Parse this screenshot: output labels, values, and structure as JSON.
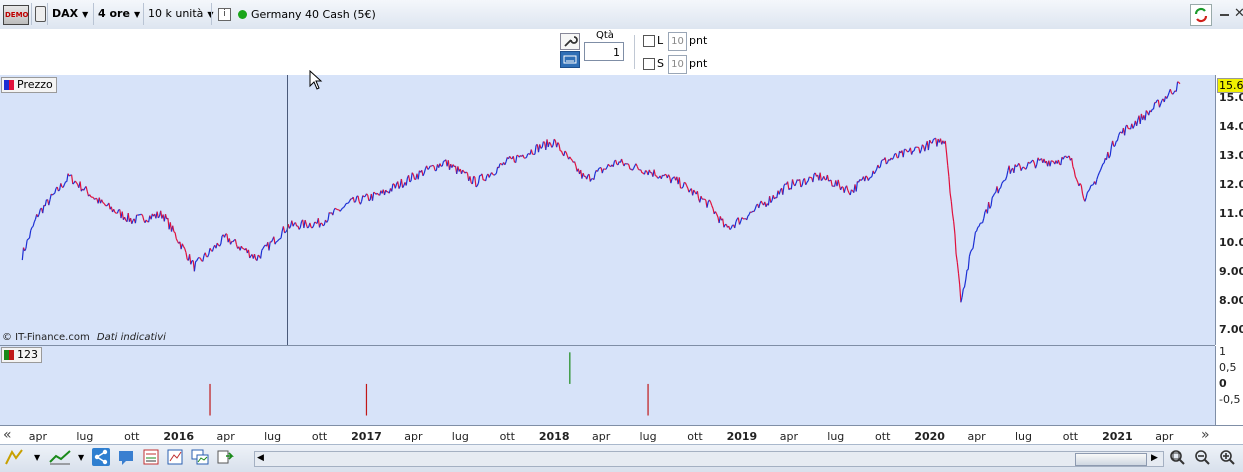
{
  "toolbar": {
    "demo_badge": "DEMO",
    "instrument": "DAX",
    "timeframe": "4 ore",
    "units": "10 k unità",
    "info_icon": "i",
    "market_name": "Germany 40 Cash (5€)"
  },
  "order": {
    "qty_label": "Qtà",
    "qty_value": "1",
    "long_label": "L",
    "long_value": "10",
    "long_unit": "pnt",
    "short_label": "S",
    "short_value": "10",
    "short_unit": "pnt"
  },
  "price_panel": {
    "legend": "Prezzo",
    "current_price_tag": "15.6",
    "y_ticks": [
      "15.0",
      "14.00",
      "13.00",
      "12.00",
      "11.00",
      "10.00",
      "9.00",
      "8.00",
      "7.00"
    ],
    "watermark": "© IT-Finance.com",
    "watermark_note": "Dati indicativi"
  },
  "indicator_panel": {
    "legend": "123",
    "y_ticks": [
      "1",
      "0,5",
      "0",
      "-0,5"
    ]
  },
  "time_axis": {
    "labels": [
      {
        "t": "apr",
        "year": false
      },
      {
        "t": "lug",
        "year": false
      },
      {
        "t": "ott",
        "year": false
      },
      {
        "t": "2016",
        "year": true
      },
      {
        "t": "apr",
        "year": false
      },
      {
        "t": "lug",
        "year": false
      },
      {
        "t": "ott",
        "year": false
      },
      {
        "t": "2017",
        "year": true
      },
      {
        "t": "apr",
        "year": false
      },
      {
        "t": "lug",
        "year": false
      },
      {
        "t": "ott",
        "year": false
      },
      {
        "t": "2018",
        "year": true
      },
      {
        "t": "apr",
        "year": false
      },
      {
        "t": "lug",
        "year": false
      },
      {
        "t": "ott",
        "year": false
      },
      {
        "t": "2019",
        "year": true
      },
      {
        "t": "apr",
        "year": false
      },
      {
        "t": "lug",
        "year": false
      },
      {
        "t": "ott",
        "year": false
      },
      {
        "t": "2020",
        "year": true
      },
      {
        "t": "apr",
        "year": false
      },
      {
        "t": "lug",
        "year": false
      },
      {
        "t": "ott",
        "year": false
      },
      {
        "t": "2021",
        "year": true
      },
      {
        "t": "apr",
        "year": false
      }
    ],
    "scroll_left": "«",
    "scroll_right": "»"
  },
  "chart_data": [
    {
      "type": "line",
      "series": [
        {
          "name": "Prezzo",
          "x": [
            "2015-03",
            "2015-04",
            "2015-06",
            "2015-08",
            "2015-10",
            "2015-12",
            "2016-02",
            "2016-04",
            "2016-06",
            "2016-08",
            "2016-10",
            "2016-12",
            "2017-02",
            "2017-04",
            "2017-06",
            "2017-08",
            "2017-10",
            "2017-12",
            "2018-01",
            "2018-03",
            "2018-05",
            "2018-07",
            "2018-09",
            "2018-11",
            "2018-12",
            "2019-02",
            "2019-04",
            "2019-06",
            "2019-08",
            "2019-10",
            "2019-12",
            "2020-02",
            "2020-03",
            "2020-04",
            "2020-06",
            "2020-08",
            "2020-10",
            "2020-11",
            "2021-01",
            "2021-03",
            "2021-05"
          ],
          "values": [
            9.6,
            11.0,
            12.3,
            11.4,
            10.8,
            11.0,
            9.2,
            10.2,
            9.5,
            10.6,
            10.7,
            11.4,
            11.7,
            12.3,
            12.8,
            12.1,
            12.8,
            13.3,
            13.5,
            12.2,
            12.8,
            12.5,
            12.1,
            11.3,
            10.5,
            11.2,
            12.0,
            12.3,
            11.8,
            12.8,
            13.2,
            13.6,
            8.1,
            10.5,
            12.5,
            12.8,
            12.9,
            11.5,
            13.7,
            14.5,
            15.5
          ]
        }
      ],
      "ylim": [
        6.5,
        15.8
      ],
      "colors": {
        "up": "#1c2fd4",
        "down": "#e0103c"
      }
    },
    {
      "type": "bar",
      "series": [
        {
          "x": [
            "2016-03",
            "2017-01",
            "2018-02",
            "2018-07"
          ],
          "values": [
            -1,
            -1,
            1,
            -1
          ]
        }
      ],
      "ylim": [
        -1.3,
        1.2
      ],
      "colors": {
        "pos": "#1a8a1a",
        "neg": "#c01818"
      }
    }
  ]
}
